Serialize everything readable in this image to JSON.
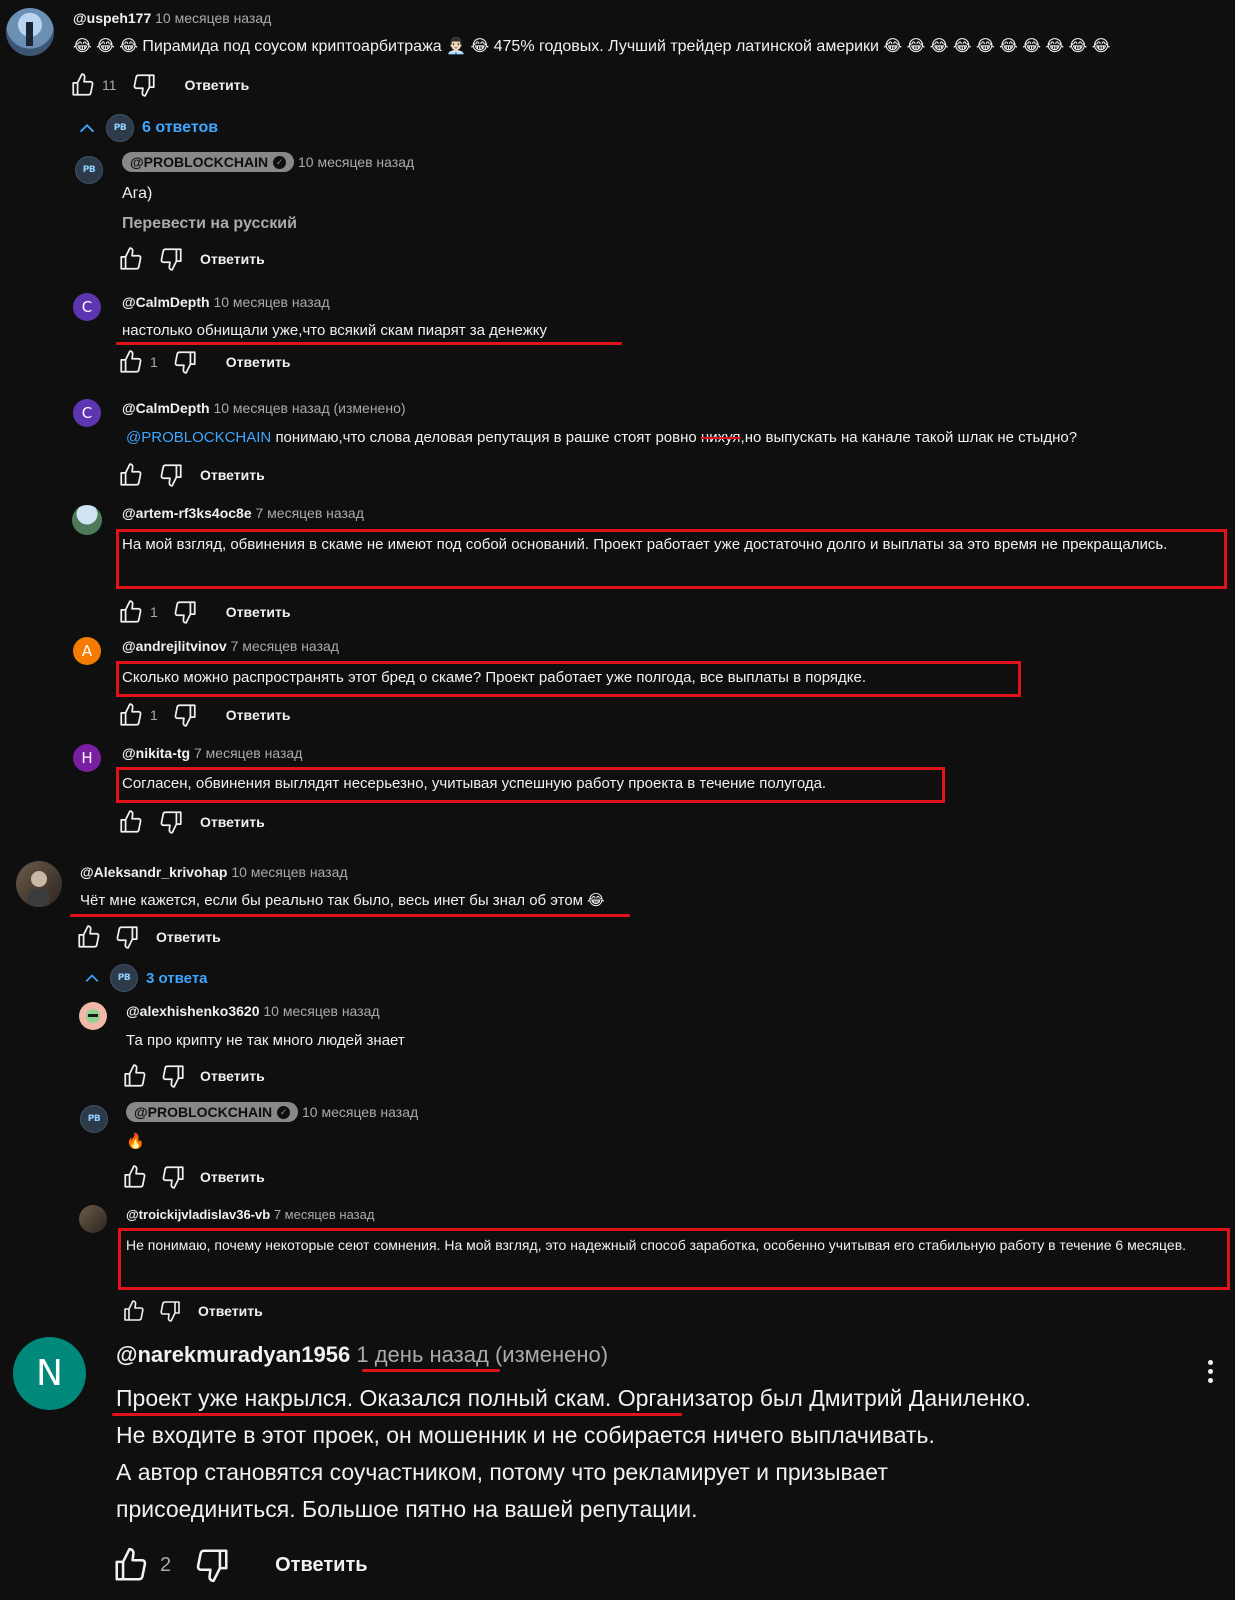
{
  "comments": {
    "c1": {
      "author": "@uspeh177",
      "time": "10 месяцев назад",
      "text": "😂 😂 😂 Пирамида под соусом криптоарбитража 👨🏻‍💼 😂 475% годовых. Лучший трейдер латинской америки 😂 😂 😂 😂 😂 😂 😂 😂 😂 😂",
      "likes": "11",
      "reply": "Ответить",
      "replies_toggle": "6 ответов"
    },
    "r1": {
      "author": "@PROBLOCKCHAIN",
      "time": "10 месяцев назад",
      "text": "Ага)",
      "translate": "Перевести на русский",
      "reply": "Ответить"
    },
    "r2": {
      "avatar_letter": "C",
      "author": "@CalmDepth",
      "time": "10 месяцев назад",
      "text": "настолько обнищали уже,что всякий скам пиарят за денежку",
      "likes": "1",
      "reply": "Ответить"
    },
    "r3": {
      "avatar_letter": "C",
      "author": "@CalmDepth",
      "time": "10 месяцев назад (изменено)",
      "mention": "@PROBLOCKCHAIN",
      "text_a": "понимаю,что слова деловая репутация в рашке стоят ровно",
      "text_strike": "нихуя",
      "text_b": ",но выпускать на канале такой шлак не стыдно?",
      "reply": "Ответить"
    },
    "r4": {
      "author": "@artem-rf3ks4oc8e",
      "time": "7 месяцев назад",
      "text": "На мой взгляд, обвинения в скаме не имеют под собой оснований. Проект работает уже достаточно долго и выплаты за это время не прекращались.",
      "likes": "1",
      "reply": "Ответить"
    },
    "r5": {
      "avatar_letter": "A",
      "author": "@andrejlitvinov",
      "time": "7 месяцев назад",
      "text": "Сколько можно распространять этот бред о скаме? Проект работает уже полгода, все выплаты в порядке.",
      "likes": "1",
      "reply": "Ответить"
    },
    "r6": {
      "avatar_letter": "H",
      "author": "@nikita-tg",
      "time": "7 месяцев назад",
      "text": "Согласен, обвинения выглядят несерьезно, учитывая успешную работу проекта в течение полугода.",
      "reply": "Ответить"
    },
    "c2": {
      "author": "@Aleksandr_krivohap",
      "time": "10 месяцев назад",
      "text": "Чёт мне кажется, если бы реально так было, весь инет бы знал об этом 😂",
      "reply": "Ответить",
      "replies_toggle": "3 ответа"
    },
    "r7": {
      "author": "@alexhishenko3620",
      "time": "10 месяцев назад",
      "text": "Та про крипту не так много людей знает",
      "reply": "Ответить"
    },
    "r8": {
      "author": "@PROBLOCKCHAIN",
      "time": "10 месяцев назад",
      "text": "🔥",
      "reply": "Ответить"
    },
    "r9": {
      "author": "@troickijvladislav36-vb",
      "time": "7 месяцев назад",
      "text": "Не понимаю, почему некоторые сеют сомнения. На мой взгляд, это надежный способ заработка, особенно учитывая его стабильную работу в течение 6 месяцев.",
      "reply": "Ответить"
    },
    "c3": {
      "avatar_letter": "N",
      "author": "@narekmuradyan1956",
      "time": "1 день назад",
      "edited": "(изменено)",
      "line1_hl": "Проект уже накрылся. Оказался полный скам.",
      "line1_rest": " Организатор был Дмитрий Даниленко.",
      "line2": "Не входите в этот проек, он мошенник и не собирается ничего выплачивать.",
      "line3": "А автор становятся соучастником, потому что рекламирует и призывает",
      "line4": "присоединиться. Большое пятно на вашей репутации.",
      "likes": "2",
      "reply": "Ответить"
    }
  },
  "colors": {
    "background": "#0f0f0f",
    "text": "#f1f1f1",
    "secondary": "#aaaaaa",
    "link": "#3ea6ff",
    "highlight": "#e1131a",
    "avatar_c": "#5e35b1",
    "avatar_a": "#f57c00",
    "avatar_h": "#7b1fa2",
    "avatar_n": "#00897b"
  },
  "icons": [
    "thumb-up-icon",
    "thumb-down-icon",
    "chevron-up-icon",
    "verified-check-icon",
    "more-vert-icon"
  ]
}
